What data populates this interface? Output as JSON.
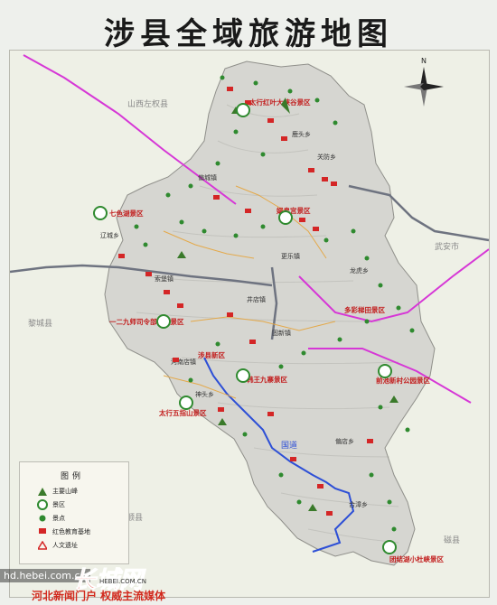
{
  "title": "涉县全域旅游地图",
  "compass": {
    "north": "N"
  },
  "regions": {
    "shanxi_zuoquan": "山西左权县",
    "licheng": "黎城县",
    "pingshun": "平顺县",
    "wuan": "武安市",
    "cixian": "磁县"
  },
  "scenic_areas": [
    "太行红叶大峡谷景区",
    "七色湖景区",
    "娲皇宫景区",
    "一二九师司令部旧址景区",
    "涉县新区",
    "多彩梯田景区",
    "韩王九寨景区",
    "太行五指山景区",
    "前池新村公园景区",
    "团结湖小杜峡景区"
  ],
  "towns": [
    "偏城镇",
    "辽城乡",
    "河南店镇",
    "井店镇",
    "神头乡",
    "鹿头乡",
    "关防乡",
    "龙虎乡",
    "合漳乡",
    "索堡镇",
    "固新镇",
    "更乐镇",
    "偏店乡"
  ],
  "highway": "国道",
  "legend": {
    "title": "图例",
    "items": [
      "主要山峰",
      "景区",
      "景点",
      "红色教育基地",
      "人文遗址"
    ]
  },
  "watermark": {
    "url": "hd.hebei.com.cn",
    "logo": "长城网",
    "site": "HEBEI.COM.CN",
    "tagline": "河北新闻门户  权威主流媒体"
  },
  "colors": {
    "county_fill": "#d9d9d4",
    "route_blue": "#2d4fd6",
    "rail_magenta": "#d637d6",
    "road_grey": "#6e7380",
    "scenic_green": "#2f8a2f",
    "red_base": "#d42626"
  }
}
